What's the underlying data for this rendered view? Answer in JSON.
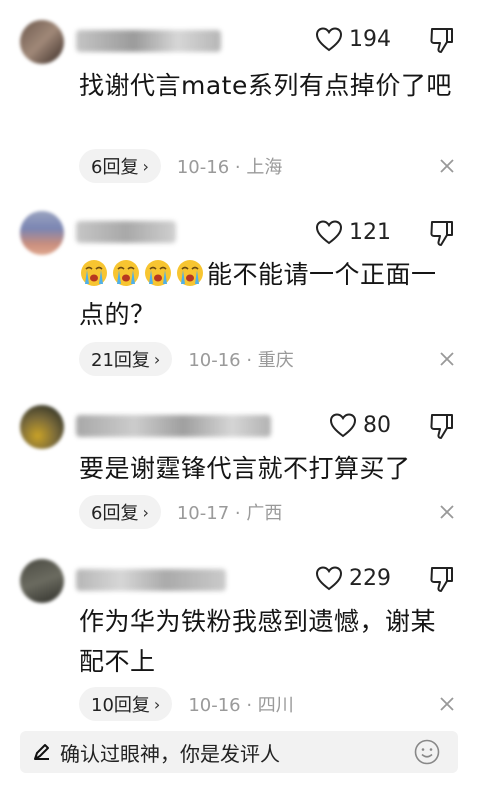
{
  "comments": [
    {
      "likes": "194",
      "content": "找谢代言mate系列有点掉价了吧",
      "replies": "6回复",
      "time": "10-16 · 上海"
    },
    {
      "likes": "121",
      "content": "能不能请一个正面一点的？",
      "replies": "21回复",
      "time": "10-16 · 重庆"
    },
    {
      "likes": "80",
      "content": "要是谢霆锋代言就不打算买了",
      "replies": "6回复",
      "time": "10-17 · 广西"
    },
    {
      "likes": "229",
      "content": "作为华为铁粉我感到遗憾，谢某配不上",
      "replies": "10回复",
      "time": "10-16 · 四川"
    }
  ],
  "input": {
    "placeholder": "确认过眼神，你是发评人"
  },
  "icons": {
    "like": "heart-outline-icon",
    "dislike": "thumbs-down-icon",
    "close": "close-icon",
    "chevron": "chevron-right-icon",
    "emoji": "crying-emoji-icon",
    "pen": "pen-icon",
    "smile": "smile-face-icon"
  }
}
